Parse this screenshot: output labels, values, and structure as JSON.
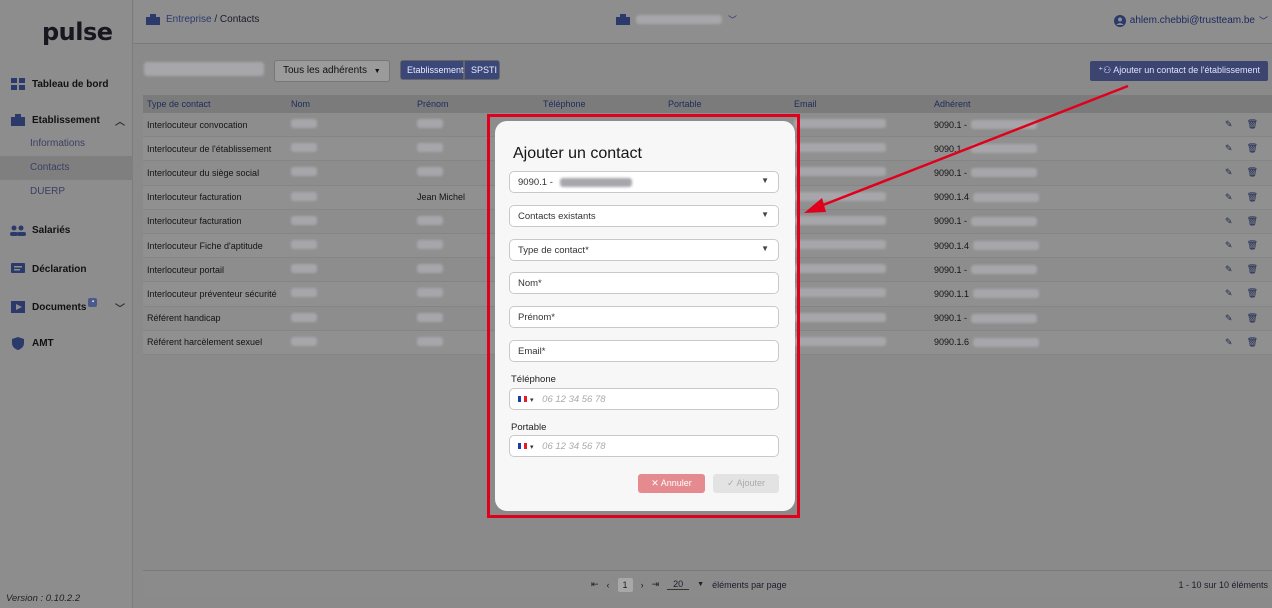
{
  "app": {
    "logo": "pulse",
    "version": "Version : 0.10.2.2"
  },
  "sidebar": {
    "items": [
      {
        "label": "Tableau de bord",
        "icon": "dashboard-icon"
      },
      {
        "label": "Etablissement",
        "icon": "building-icon",
        "sub": [
          "Informations",
          "Contacts",
          "DUERP"
        ]
      },
      {
        "label": "Salariés",
        "icon": "people-icon"
      },
      {
        "label": "Déclaration",
        "icon": "message-icon"
      },
      {
        "label": "Documents",
        "icon": "document-icon"
      },
      {
        "label": "AMT",
        "icon": "shield-icon"
      }
    ],
    "active_sub": "Contacts"
  },
  "header": {
    "breadcrumb_root": "Entreprise",
    "breadcrumb_sep": " / ",
    "breadcrumb_current": "Contacts",
    "user_email": "ahlem.chebbi@trustteam.be"
  },
  "toolbar": {
    "adherents_select": "Tous les adhérents",
    "toggle_establishment": "Etablissement",
    "toggle_spsti": "SPSTI",
    "add_contact_button": "Ajouter un contact de l'établissement"
  },
  "table": {
    "columns": [
      "Type de contact",
      "Nom",
      "Prénom",
      "Téléphone",
      "Portable",
      "Email",
      "Adhérent"
    ],
    "rows": [
      {
        "type": "Interlocuteur convocation",
        "adherent": "9090.1 -"
      },
      {
        "type": "Interlocuteur de l'établissement",
        "adherent": "9090.1 -"
      },
      {
        "type": "Interlocuteur du siège social",
        "adherent": "9090.1 -"
      },
      {
        "type": "Interlocuteur facturation",
        "prenom": "Jean Michel",
        "adherent": "9090.1.4"
      },
      {
        "type": "Interlocuteur facturation",
        "adherent": "9090.1 -"
      },
      {
        "type": "Interlocuteur Fiche d'aptitude",
        "adherent": "9090.1.4"
      },
      {
        "type": "Interlocuteur portail",
        "adherent": "9090.1 -"
      },
      {
        "type": "Interlocuteur préventeur sécurité",
        "adherent": "9090.1.1"
      },
      {
        "type": "Référent handicap",
        "adherent": "9090.1 -"
      },
      {
        "type": "Référent harcèlement sexuel",
        "adherent": "9090.1.6"
      }
    ]
  },
  "pagination": {
    "current_page": "1",
    "page_size": "20",
    "page_size_label": "éléments par page",
    "count_label": "1 - 10 sur 10 éléments"
  },
  "modal": {
    "title": "Ajouter un contact",
    "adherent_value": "9090.1 -",
    "existing_contacts": "Contacts existants",
    "contact_type": "Type de contact*",
    "nom": "Nom*",
    "prenom": "Prénom*",
    "email": "Email*",
    "telephone_label": "Téléphone",
    "telephone_placeholder": "06 12 34 56 78",
    "portable_label": "Portable",
    "portable_placeholder": "06 12 34 56 78",
    "cancel_button": "Annuler",
    "add_button": "Ajouter"
  },
  "colors": {
    "highlight": "#e0001b",
    "accent": "#3b4778",
    "cancel": "#e58a8e"
  }
}
